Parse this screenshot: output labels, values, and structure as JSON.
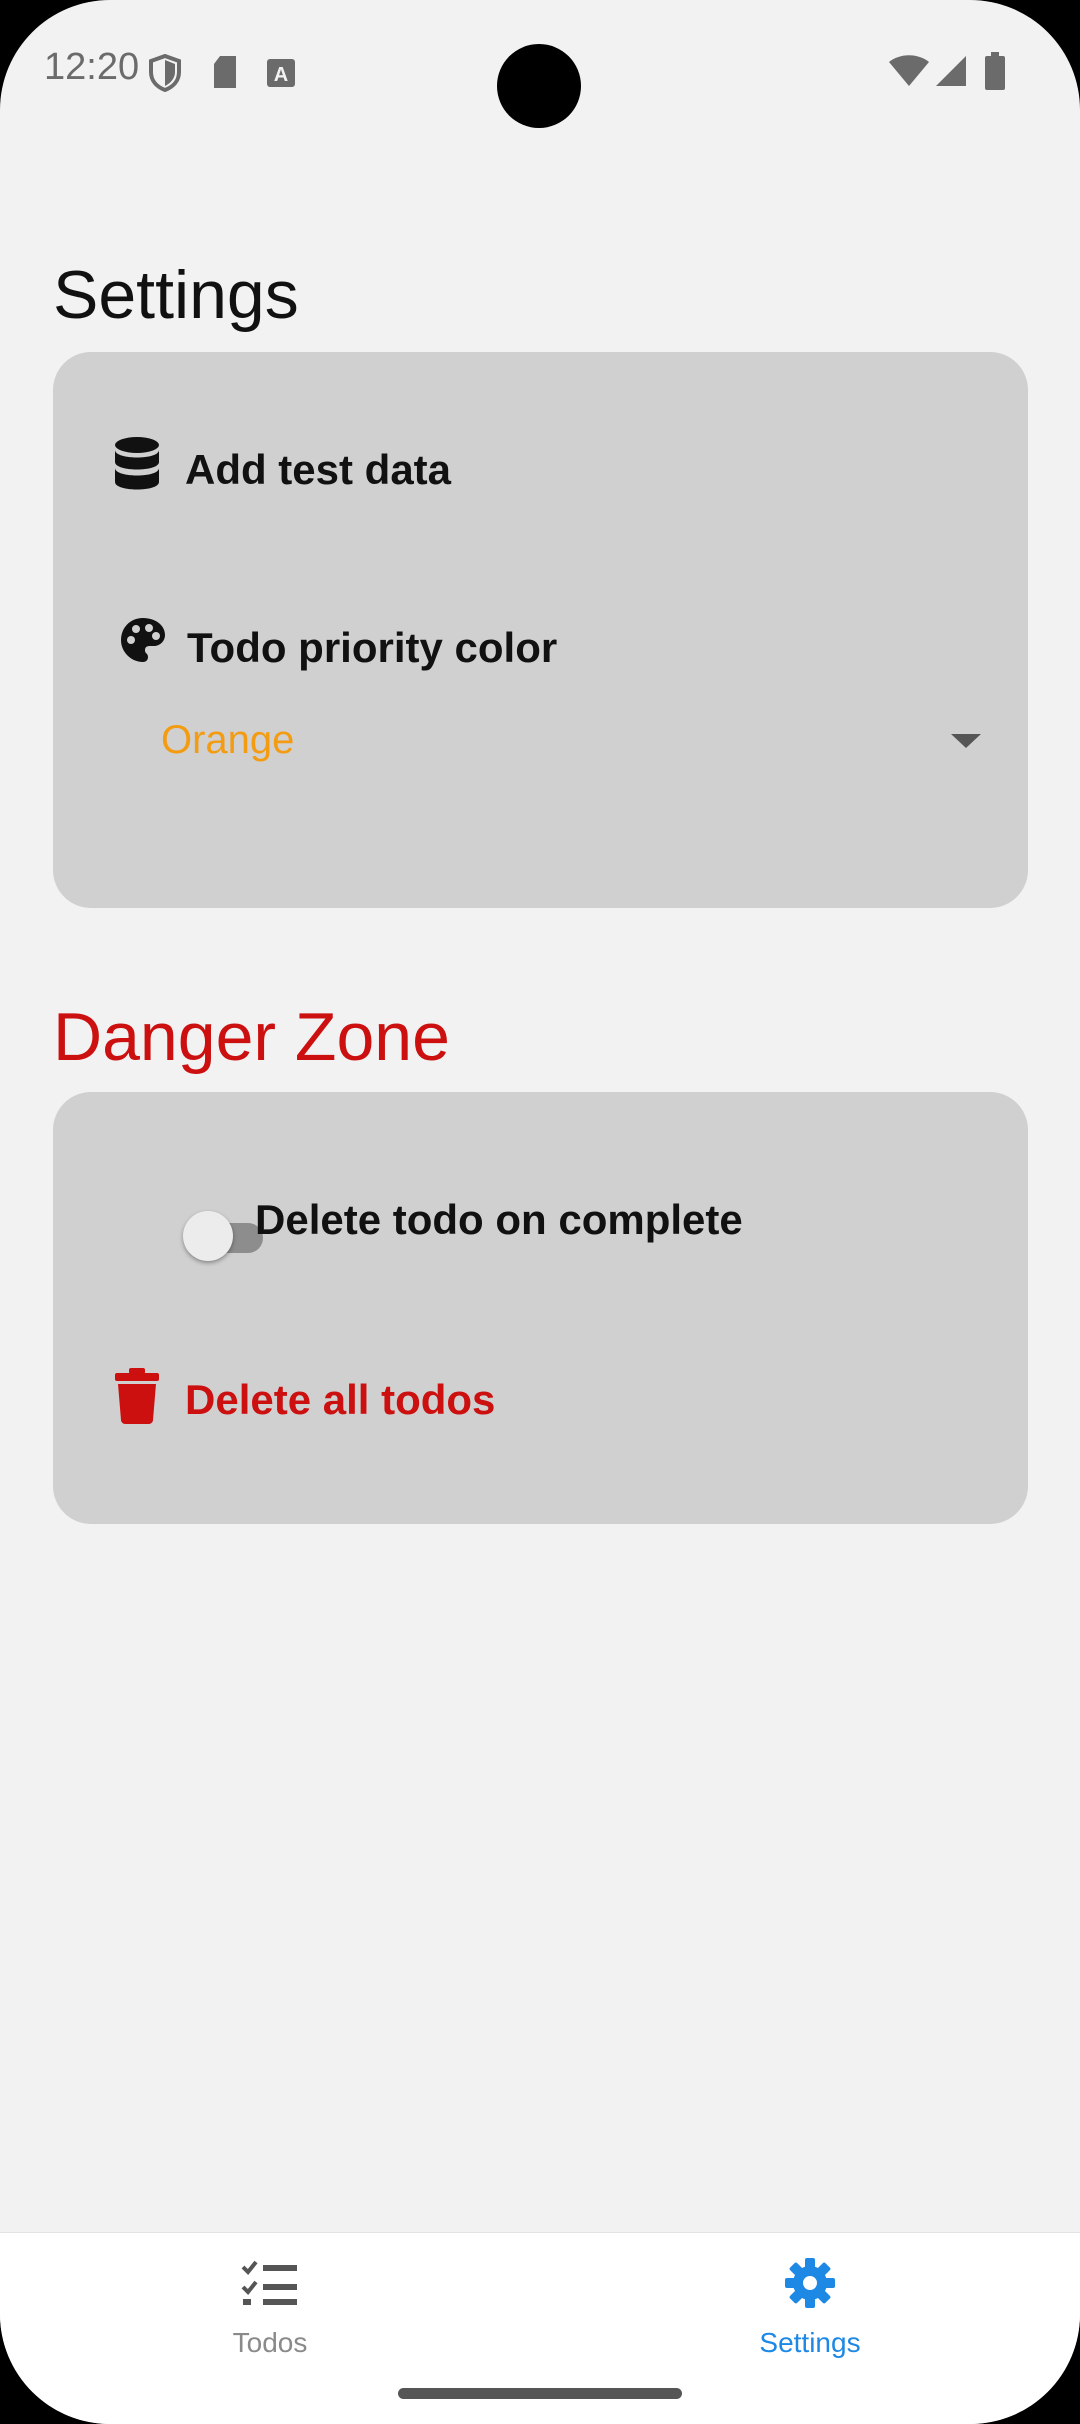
{
  "status_bar": {
    "time": "12:20"
  },
  "page": {
    "title": "Settings"
  },
  "settings_card": {
    "add_test_data": "Add test data",
    "priority_color_label": "Todo priority color",
    "priority_color_value": "Orange"
  },
  "danger_zone": {
    "title": "Danger Zone",
    "delete_on_complete_label": "Delete todo on complete",
    "delete_on_complete_enabled": false,
    "delete_all_label": "Delete all todos"
  },
  "bottom_nav": {
    "items": [
      {
        "label": "Todos",
        "icon": "checklist-icon",
        "active": false
      },
      {
        "label": "Settings",
        "icon": "gear-icon",
        "active": true
      }
    ]
  },
  "colors": {
    "accent": "#1e88e5",
    "danger": "#cc1010",
    "priority": "#f39c12"
  }
}
